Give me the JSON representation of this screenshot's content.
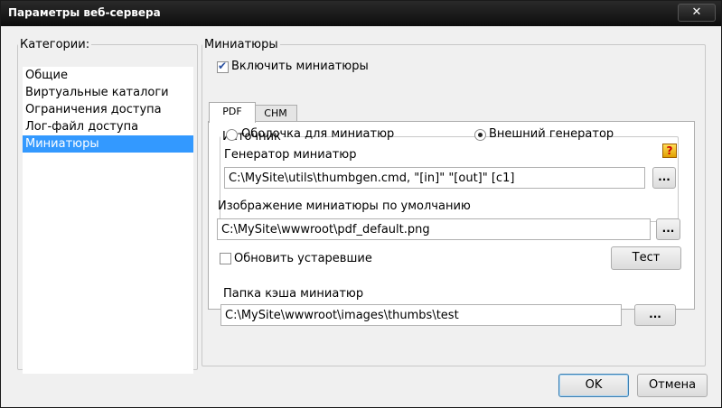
{
  "window": {
    "title": "Параметры веб-сервера",
    "close_glyph": "✕"
  },
  "categories": {
    "legend": "Категории:",
    "items": [
      "Общие",
      "Виртуальные каталоги",
      "Ограничения доступа",
      "Лог-файл доступа",
      "Миниатюры"
    ],
    "selected": "Миниатюры"
  },
  "thumbnails": {
    "legend": "Миниатюры",
    "enable_label": "Включить миниатюры",
    "enable_checked": true,
    "tabs": [
      {
        "label": "PDF",
        "active": true
      },
      {
        "label": "CHM",
        "active": false
      }
    ],
    "source": {
      "legend": "Источник",
      "option_shell": "Оболочка для миниатюр",
      "option_external": "Внешний генератор",
      "selected": "Внешний генератор",
      "help_icon": "help-icon"
    },
    "generator": {
      "label": "Генератор миниатюр",
      "value": "C:\\MySite\\utils\\thumbgen.cmd, \"[in]\" \"[out]\" [c1]",
      "browse_label": "..."
    },
    "default_image": {
      "label": "Изображение миниатюры по умолчанию",
      "value": "C:\\MySite\\wwwroot\\pdf_default.png",
      "browse_label": "..."
    },
    "update_outdated": {
      "label": "Обновить устаревшие",
      "checked": false
    },
    "test_label": "Тест",
    "cache_folder": {
      "label": "Папка кэша миниатюр",
      "value": "C:\\MySite\\wwwroot\\images\\thumbs\\test",
      "browse_label": "..."
    }
  },
  "dialog_buttons": {
    "ok_label": "OK",
    "cancel_label": "Отмена"
  }
}
